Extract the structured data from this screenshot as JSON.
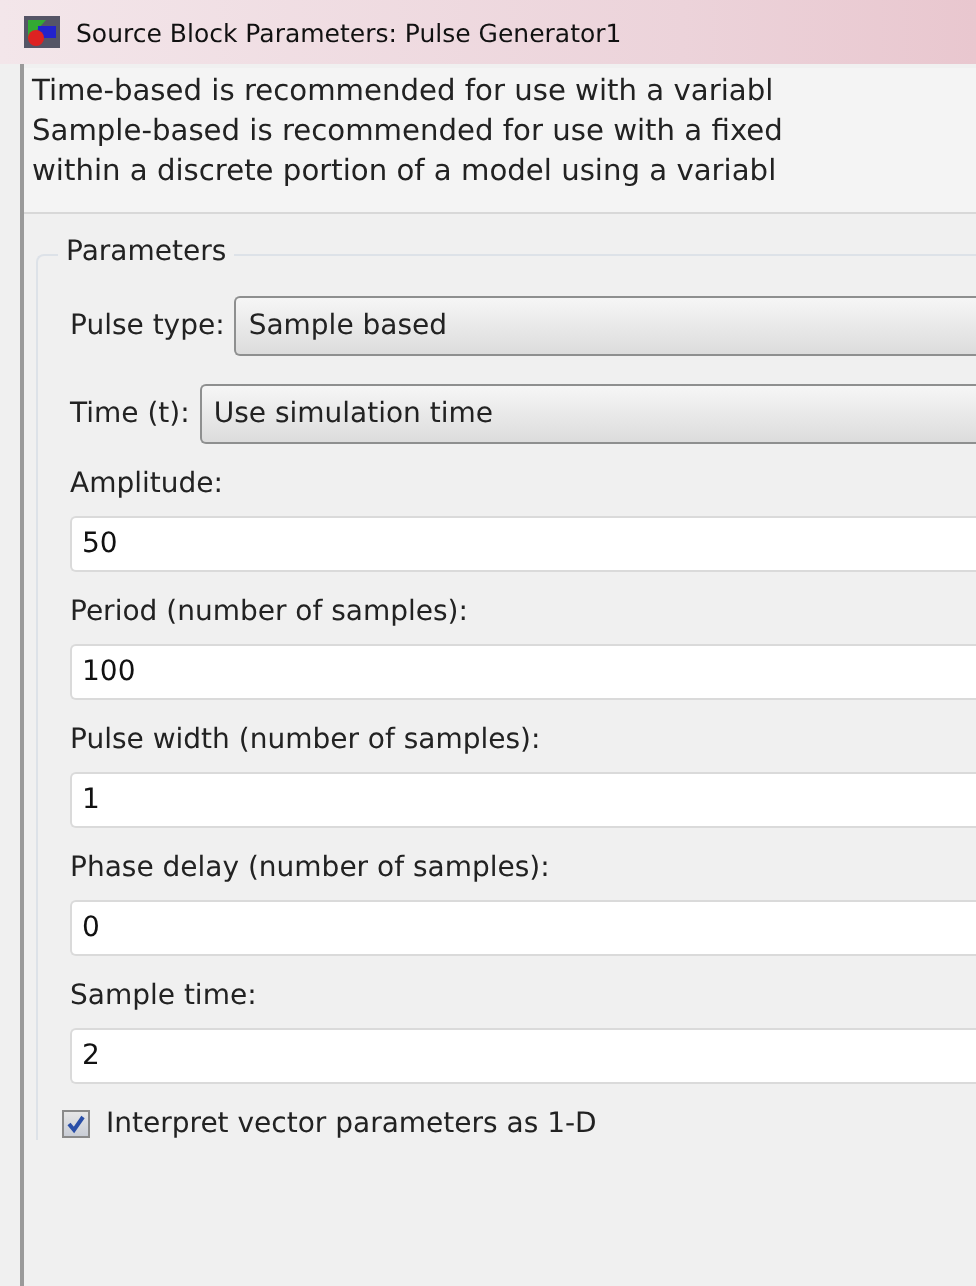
{
  "window": {
    "title": "Source Block Parameters: Pulse Generator1"
  },
  "description": [
    "Time-based is recommended for use with a variabl",
    "Sample-based is recommended for use with a fixed",
    "within a discrete portion of a model using a variabl"
  ],
  "parameters": {
    "title": "Parameters",
    "dropdowns": [
      {
        "label": "Pulse type:",
        "value": "Sample based"
      },
      {
        "label": "Time (t):",
        "value": "Use simulation time"
      }
    ],
    "fields": [
      {
        "label": "Amplitude:",
        "value": "50"
      },
      {
        "label": "Period (number of samples):",
        "value": "100"
      },
      {
        "label": "Pulse width (number of samples):",
        "value": "1"
      },
      {
        "label": "Phase delay (number of samples):",
        "value": "0"
      },
      {
        "label": "Sample time:",
        "value": "2"
      }
    ],
    "checkbox": {
      "label": "Interpret vector parameters as 1-D",
      "checked": true
    }
  }
}
